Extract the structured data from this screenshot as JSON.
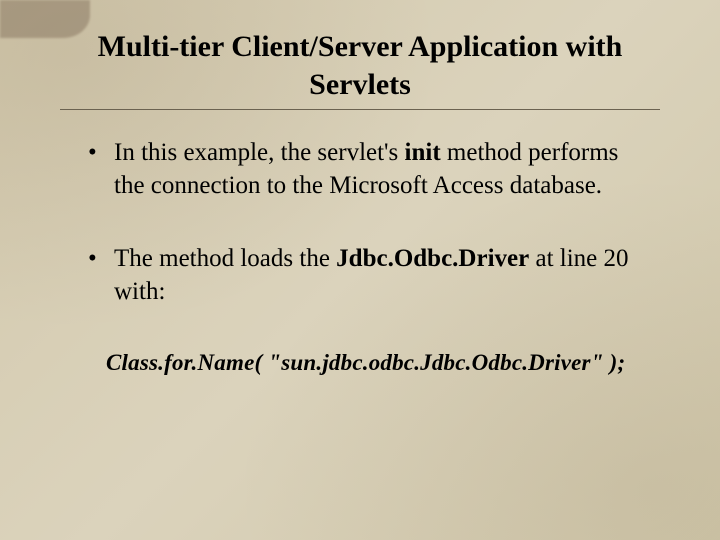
{
  "title": "Multi-tier Client/Server Application with Servlets",
  "bullets": [
    {
      "pre": "In this example, the servlet's ",
      "bold": "init",
      "post": " method performs the connection to the Microsoft Access database."
    },
    {
      "pre": "The method loads the ",
      "bold": "Jdbc.Odbc.Driver",
      "post": " at line 20 with:"
    }
  ],
  "code": "Class.for.Name( \"sun.jdbc.odbc.Jdbc.Odbc.Driver\" );"
}
